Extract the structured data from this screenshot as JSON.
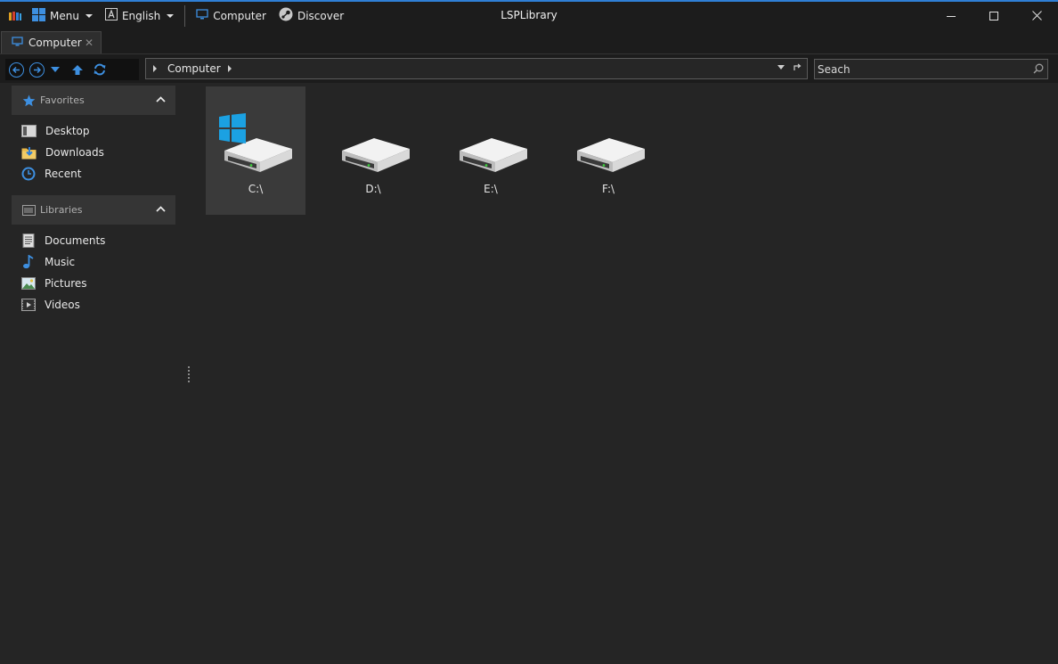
{
  "window": {
    "title": "LSPLibrary",
    "menu_label": "Menu",
    "language_label": "English",
    "computer_label": "Computer",
    "discover_label": "Discover"
  },
  "tabs": [
    {
      "label": "Computer"
    }
  ],
  "address": {
    "crumb": "Computer"
  },
  "search": {
    "placeholder": "Seach"
  },
  "sidebar": {
    "favorites": {
      "title": "Favorites",
      "items": [
        {
          "label": "Desktop",
          "icon": "desktop-icon"
        },
        {
          "label": "Downloads",
          "icon": "downloads-folder-icon"
        },
        {
          "label": "Recent",
          "icon": "clock-icon"
        }
      ]
    },
    "libraries": {
      "title": "Libraries",
      "items": [
        {
          "label": "Documents",
          "icon": "document-icon"
        },
        {
          "label": "Music",
          "icon": "music-note-icon"
        },
        {
          "label": "Pictures",
          "icon": "picture-icon"
        },
        {
          "label": "Videos",
          "icon": "video-icon"
        }
      ]
    }
  },
  "drives": [
    {
      "label": "C:\\",
      "system": true,
      "selected": true
    },
    {
      "label": "D:\\",
      "system": false,
      "selected": false
    },
    {
      "label": "E:\\",
      "system": false,
      "selected": false
    },
    {
      "label": "F:\\",
      "system": false,
      "selected": false
    }
  ],
  "colors": {
    "accent": "#2f7fd6",
    "windows_logo": "#1ba1e2",
    "background": "#252525"
  }
}
